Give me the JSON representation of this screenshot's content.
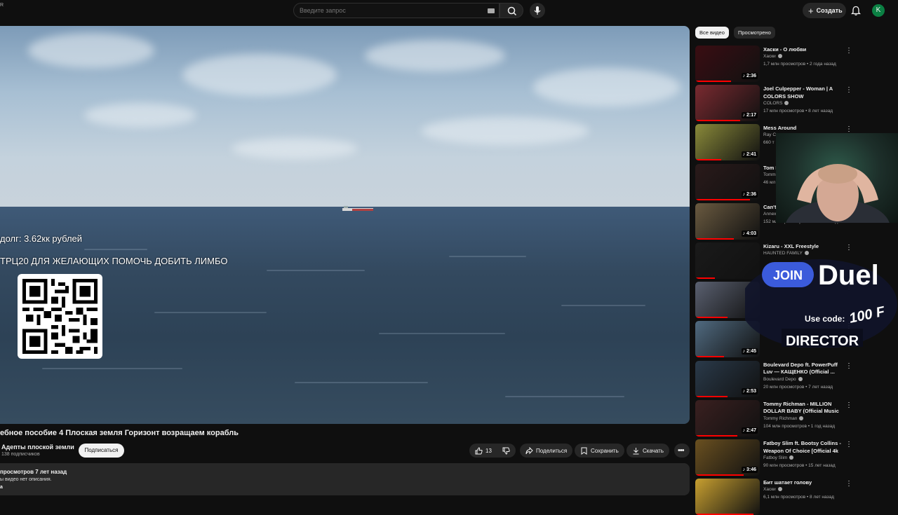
{
  "topbar": {
    "corner_text": "R",
    "search_placeholder": "Введите запрос",
    "create_label": "Создать",
    "avatar_letter": "K"
  },
  "player": {
    "overlay_line1": "долг: 3.62кк рублей",
    "overlay_line2": "ТРЦ20 ДЛЯ ЖЕЛАЮЩИХ ПОМОЧЬ ДОБИТЬ ЛИМБО"
  },
  "video": {
    "title": "ебное пособие 4 Плоская земля Горизонт возращаем корабль",
    "channel": "Адепты плоской земли",
    "subscribers": "138 подписчиков",
    "subscribe_label": "Подписаться",
    "likes": "13",
    "share_label": "Поделиться",
    "save_label": "Сохранить",
    "download_label": "Скачать",
    "desc_meta": "просмотров  7 лет назад",
    "desc_text": "ы видео нет описания.",
    "desc_more": "а"
  },
  "chips": {
    "all": "Все видео",
    "watched": "Просмотрено"
  },
  "recommendations": [
    {
      "title": "Хаски - О любви",
      "channel": "Хаски",
      "stats": "1,7 млн просмотров • 2 года назад",
      "duration": "2:36",
      "progress": 0.55,
      "color": "#3a0d12"
    },
    {
      "title": "Joel Culpepper - Woman | A COLORS SHOW",
      "channel": "COLORS",
      "stats": "17 млн просмотров • 8 лет назад",
      "duration": "2:17",
      "progress": 0.7,
      "color": "#7a2a30"
    },
    {
      "title": "Mess Around",
      "channel": "Ray C",
      "stats": "660 т",
      "duration": "2:41",
      "progress": 0.4,
      "color": "#8a8a3a"
    },
    {
      "title": "Tom DOLL",
      "channel": "Tomm",
      "stats": "46 мл",
      "duration": "2:36",
      "progress": 0.85,
      "color": "#2a1a1a"
    },
    {
      "title": "Can't (Кав",
      "channel": "Annex",
      "stats": "152 млн просмотров • 15 лет назад",
      "duration": "4:03",
      "progress": 0.6,
      "color": "#6a5a40"
    },
    {
      "title": "Kizaru - XXL Freestyle",
      "channel": "HAUNTED FAMILY",
      "stats": "",
      "duration": "",
      "progress": 0.3,
      "color": "#1a1a1a"
    },
    {
      "title": "",
      "channel": "",
      "stats": "",
      "duration": "",
      "progress": 0.5,
      "color": "#5a6070"
    },
    {
      "title": "",
      "channel": "",
      "stats": "",
      "duration": "2:45",
      "progress": 0.45,
      "color": "#506a80"
    },
    {
      "title": "Boulevard Depo ft. PowerPuff Luv — КАЩЕНКО (Official ...",
      "channel": "Boulevard Depo",
      "stats": "20 млн просмотров • 7 лет назад",
      "duration": "2:53",
      "progress": 0.5,
      "color": "#2a3a4a"
    },
    {
      "title": "Tommy Richman - MILLION DOLLAR BABY (Official Music ...",
      "channel": "Tommy Richman",
      "stats": "104 млн просмотров • 1 год назад",
      "duration": "2:47",
      "progress": 0.65,
      "color": "#3a2020"
    },
    {
      "title": "Fatboy Slim ft. Bootsy Collins - Weapon Of Choice [Official 4k ...",
      "channel": "Fatboy Slim",
      "stats": "90 млн просмотров • 15 лет назад",
      "duration": "3:46",
      "progress": 0.75,
      "color": "#6a5020"
    },
    {
      "title": "Бит шатает голову",
      "channel": "Хаски",
      "stats": "6,1 млн просмотров • 8 лет назад",
      "duration": "",
      "progress": 0.9,
      "color": "#c8a030"
    }
  ],
  "ad": {
    "join": "JOIN",
    "brand": "Duel",
    "use_code": "Use code:",
    "amount": "100 F",
    "code": "DIRECTOR"
  },
  "colors": {
    "background": "#0f0f0f",
    "accent_red": "#ff0000",
    "ad_blue": "#3b5bdb"
  },
  "icons": [
    "search-icon",
    "mic-icon",
    "plus-icon",
    "bell-icon",
    "like-icon",
    "dislike-icon",
    "share-icon",
    "save-icon",
    "download-icon",
    "more-icon",
    "kebab-icon",
    "shorts-icon"
  ]
}
